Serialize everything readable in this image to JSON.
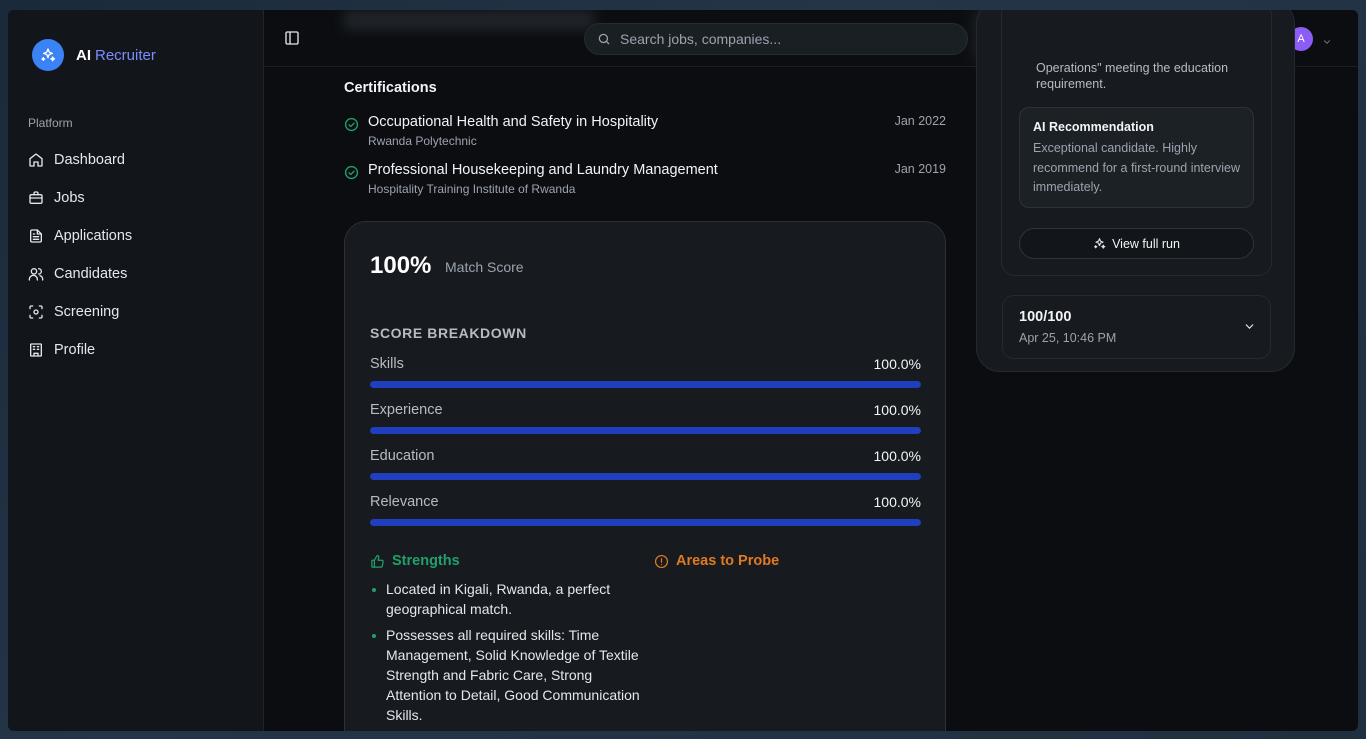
{
  "brand": {
    "name": "AI",
    "sub": "Recruiter"
  },
  "sidebar": {
    "section": "Platform",
    "items": [
      {
        "label": "Dashboard",
        "icon": "home-icon"
      },
      {
        "label": "Jobs",
        "icon": "briefcase-icon"
      },
      {
        "label": "Applications",
        "icon": "document-icon"
      },
      {
        "label": "Candidates",
        "icon": "users-icon"
      },
      {
        "label": "Screening",
        "icon": "scan-icon"
      },
      {
        "label": "Profile",
        "icon": "building-icon"
      }
    ]
  },
  "topbar": {
    "search_placeholder": "Search jobs, companies...",
    "avatar_initial": "A"
  },
  "certifications": {
    "title": "Certifications",
    "items": [
      {
        "name": "Occupational Health and Safety in Hospitality",
        "org": "Rwanda Polytechnic",
        "date": "Jan 2022"
      },
      {
        "name": "Professional Housekeeping and Laundry Management",
        "org": "Hospitality Training Institute of Rwanda",
        "date": "Jan 2019"
      }
    ]
  },
  "score": {
    "value": "100%",
    "label": "Match Score",
    "breakdown_title": "SCORE BREAKDOWN",
    "rows": [
      {
        "label": "Skills",
        "value": "100.0%",
        "fraction": 1.0
      },
      {
        "label": "Experience",
        "value": "100.0%",
        "fraction": 1.0
      },
      {
        "label": "Education",
        "value": "100.0%",
        "fraction": 1.0
      },
      {
        "label": "Relevance",
        "value": "100.0%",
        "fraction": 1.0
      }
    ],
    "strengths_title": "Strengths",
    "strengths": [
      "Located in Kigali, Rwanda, a perfect geographical match.",
      "Possesses all required skills: Time Management, Solid Knowledge of Textile Strength and Fabric Care, Strong Attention to Detail, Good Communication Skills."
    ],
    "probe_title": "Areas to Probe"
  },
  "right_panel": {
    "truncated_text": "Operations\" meeting the education requirement.",
    "recommendation_title": "AI Recommendation",
    "recommendation_body": "Exceptional candidate. Highly recommend for a first-round interview immediately.",
    "view_run_label": "View full run",
    "run_score": "100/100",
    "run_date": "Apr 25, 10:46 PM"
  },
  "colors": {
    "accent_blue": "#3b82f6",
    "bar_fill": "#1f3fbf",
    "strengths_green": "#22a06b",
    "probe_orange": "#e07a1f",
    "avatar_purple": "#8b5cf6"
  }
}
